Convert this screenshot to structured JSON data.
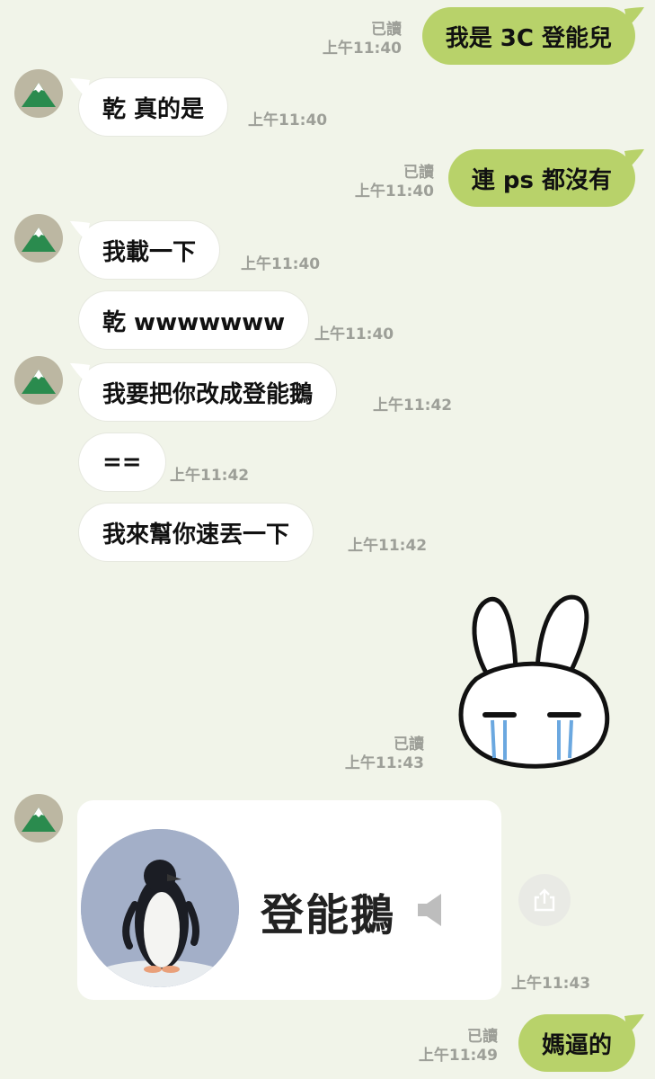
{
  "colors": {
    "background": "#f1f4e9",
    "outgoing_bubble": "#b8d26a",
    "incoming_bubble": "#ffffff",
    "meta_text": "#9d9f98"
  },
  "messages": [
    {
      "id": 1,
      "side": "out",
      "text": "我是 3C 登能兒",
      "read": "已讀",
      "time": "上午11:40"
    },
    {
      "id": 2,
      "side": "in",
      "text": "乾 真的是",
      "time": "上午11:40"
    },
    {
      "id": 3,
      "side": "out",
      "text": "連 ps 都沒有",
      "read": "已讀",
      "time": "上午11:40"
    },
    {
      "id": 4,
      "side": "in",
      "text": "我載一下",
      "time": "上午11:40"
    },
    {
      "id": 5,
      "side": "in",
      "text": "乾 wwwwwww",
      "time": "上午11:40"
    },
    {
      "id": 6,
      "side": "in",
      "text": "我要把你改成登能鵝",
      "time": "上午11:42"
    },
    {
      "id": 7,
      "side": "in",
      "text": "==",
      "time": "上午11:42"
    },
    {
      "id": 8,
      "side": "in",
      "text": "我來幫你速丟一下",
      "time": "上午11:42"
    },
    {
      "id": 9,
      "side": "out",
      "type": "sticker",
      "sticker_icon": "crying-bunny-sticker",
      "read": "已讀",
      "time": "上午11:43"
    },
    {
      "id": 10,
      "side": "in",
      "type": "media",
      "label": "登能鵝",
      "time": "上午11:43"
    },
    {
      "id": 11,
      "side": "out",
      "text": "媽逼的",
      "read": "已讀",
      "time": "上午11:49"
    }
  ]
}
